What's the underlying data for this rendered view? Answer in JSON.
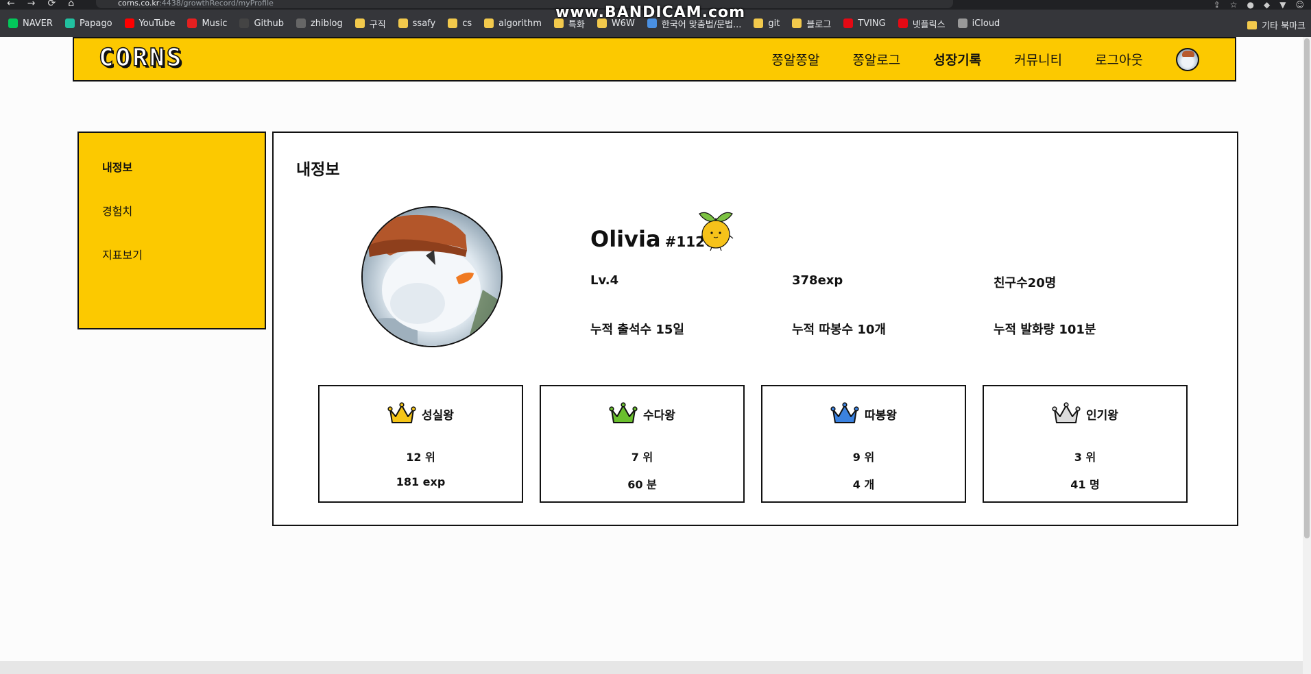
{
  "browser": {
    "url_host": "corns.co.kr",
    "url_path": ":4438/growthRecord/myProfile",
    "watermark": "www.BANDICAM.com",
    "bookmarks": [
      {
        "label": "NAVER",
        "color": "#03c75a"
      },
      {
        "label": "Papago",
        "color": "#21c0a0"
      },
      {
        "label": "YouTube",
        "color": "#ff0000"
      },
      {
        "label": "Music",
        "color": "#e52020"
      },
      {
        "label": "Github",
        "color": "#444444"
      },
      {
        "label": "zhiblog",
        "color": "#666666"
      },
      {
        "label": "구직",
        "color": "#f2c94c"
      },
      {
        "label": "ssafy",
        "color": "#f2c94c"
      },
      {
        "label": "cs",
        "color": "#f2c94c"
      },
      {
        "label": "algorithm",
        "color": "#f2c94c"
      },
      {
        "label": "특화",
        "color": "#f2c94c"
      },
      {
        "label": "W6W",
        "color": "#f2c94c"
      },
      {
        "label": "한국어 맞춤법/문법...",
        "color": "#4a90e2"
      },
      {
        "label": "git",
        "color": "#f2c94c"
      },
      {
        "label": "블로그",
        "color": "#f2c94c"
      },
      {
        "label": "TVING",
        "color": "#e50914"
      },
      {
        "label": "넷플릭스",
        "color": "#e50914"
      },
      {
        "label": "iCloud",
        "color": "#999999"
      }
    ],
    "bookmarks_other": "기타 북마크"
  },
  "header": {
    "logo": "CORNS",
    "nav": [
      {
        "label": "쫑알쫑알",
        "active": false
      },
      {
        "label": "쫑알로그",
        "active": false
      },
      {
        "label": "성장기록",
        "active": true
      },
      {
        "label": "커뮤니티",
        "active": false
      },
      {
        "label": "로그아웃",
        "active": false
      }
    ]
  },
  "sidebar": {
    "items": [
      {
        "label": "내정보",
        "active": true
      },
      {
        "label": "경험치",
        "active": false
      },
      {
        "label": "지표보기",
        "active": false
      }
    ]
  },
  "main": {
    "title": "내정보",
    "user": {
      "name": "Olivia",
      "tag": "#1126"
    },
    "stats": {
      "level": "Lv.4",
      "exp": "378exp",
      "friends": "친구수20명",
      "attendance": "누적 출석수 15일",
      "ddabong": "누적 따봉수 10개",
      "speech": "누적 발화량 101분"
    },
    "cards": [
      {
        "title": "성실왕",
        "rank": "12 위",
        "value": "181 exp",
        "crown_color": "#f5c518",
        "icon": "crown-icon"
      },
      {
        "title": "수다왕",
        "rank": "7 위",
        "value": "60 분",
        "crown_color": "#6abf2e",
        "icon": "crown-icon"
      },
      {
        "title": "따봉왕",
        "rank": "9 위",
        "value": "4 개",
        "crown_color": "#3b82e0",
        "icon": "crown-icon"
      },
      {
        "title": "인기왕",
        "rank": "3 위",
        "value": "41 명",
        "crown_color": "#dcdcdc",
        "icon": "crown-icon"
      }
    ]
  },
  "colors": {
    "brand": "#fcc900",
    "border": "#111111"
  }
}
